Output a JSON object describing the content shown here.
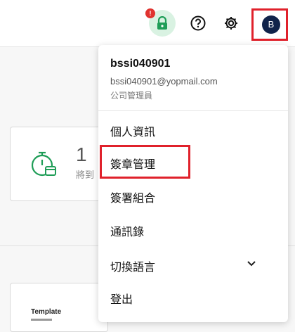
{
  "user": {
    "avatar_initial": "B",
    "username": "bssi040901",
    "email": "bssi040901@yopmail.com",
    "role": "公司管理員"
  },
  "header": {
    "notification_count": "!",
    "icons": [
      "lock-icon",
      "help-icon",
      "gear-icon",
      "avatar"
    ]
  },
  "background": {
    "stat_number": "1",
    "stat_label": "將到",
    "template_label": "Template"
  },
  "menu": {
    "items": [
      {
        "label": "個人資訊"
      },
      {
        "label": "簽章管理"
      },
      {
        "label": "簽署組合"
      },
      {
        "label": "通訊錄"
      },
      {
        "label": "切換語言"
      },
      {
        "label": "登出"
      }
    ]
  },
  "colors": {
    "accent_green": "#1f9d57",
    "highlight_red": "#e0212b",
    "avatar_navy": "#10234a"
  }
}
